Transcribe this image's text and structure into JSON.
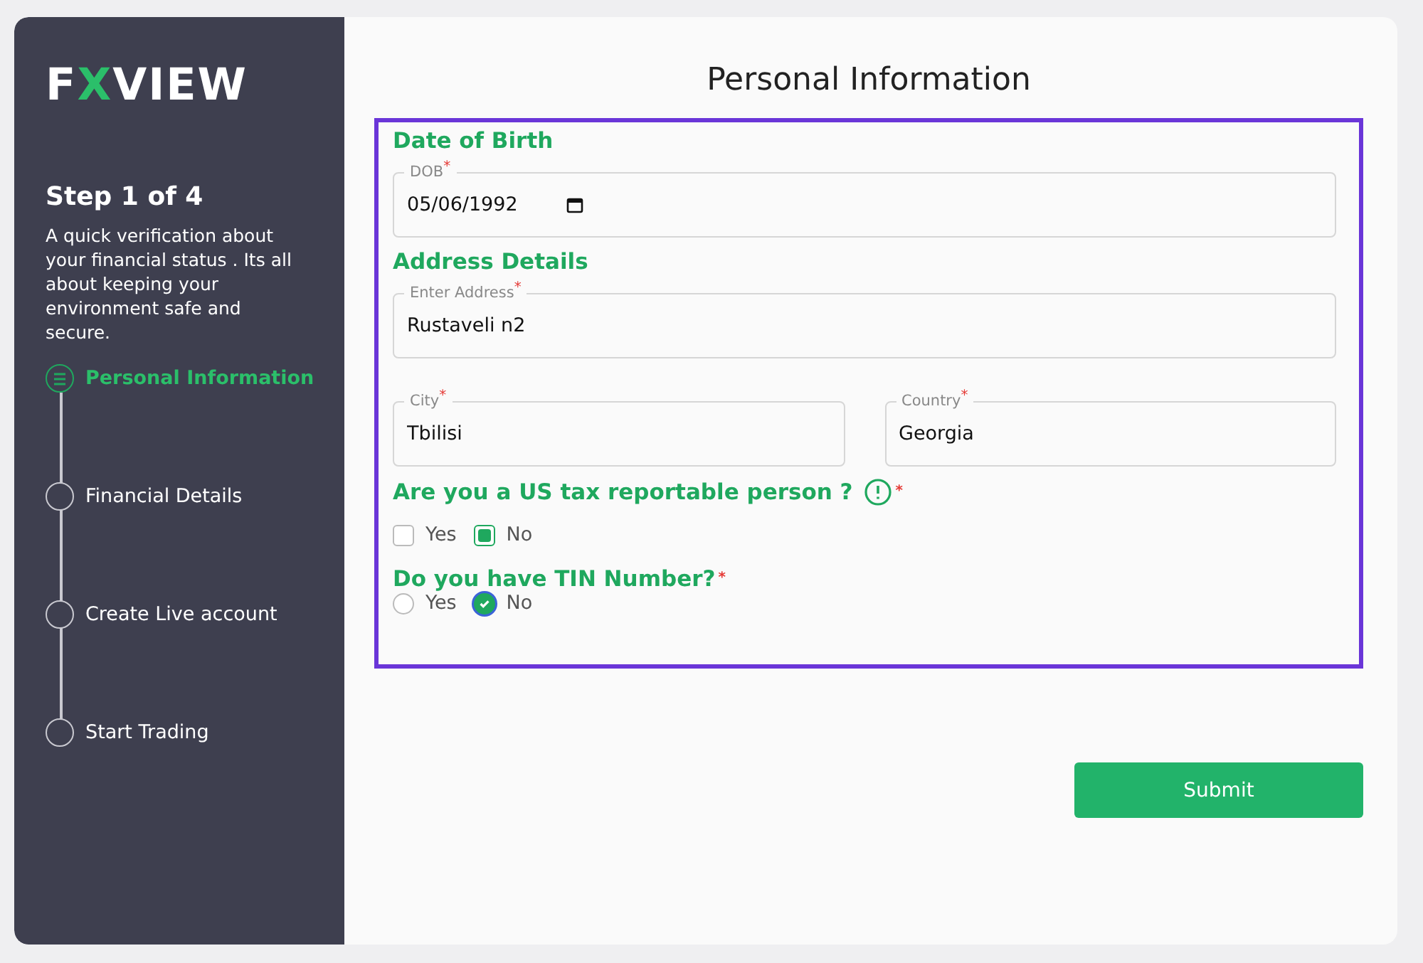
{
  "sidebar": {
    "logo": {
      "prefix": "F",
      "accent": "X",
      "suffix": "VIEW"
    },
    "step_title": "Step 1 of 4",
    "description": "A quick verification about your financial status . Its all about keeping your environment safe and secure.",
    "steps": [
      {
        "label": "Personal Information",
        "selected": true
      },
      {
        "label": "Financial Details",
        "selected": false
      },
      {
        "label": "Create Live account",
        "selected": false
      },
      {
        "label": "Start Trading",
        "selected": false
      }
    ]
  },
  "form": {
    "title": "Personal Information",
    "highlighted": true,
    "sections": [
      {
        "heading": "Date of Birth",
        "rows": [
          [
            {
              "label": "DOB",
              "required_mark": "*",
              "value": "05/06/1992",
              "kind": "date"
            }
          ]
        ]
      },
      {
        "heading": "Address Details",
        "rows": [
          [
            {
              "label": "Enter Address",
              "required_mark": "*",
              "value": "Rustaveli n2",
              "kind": "text"
            }
          ],
          [
            {
              "label": "City",
              "required_mark": "*",
              "value": "Tbilisi",
              "kind": "text"
            },
            {
              "label": "Country",
              "required_mark": "*",
              "value": "Georgia",
              "kind": "text"
            }
          ]
        ]
      }
    ],
    "questions": [
      {
        "text": "Are you a US tax reportable person ?",
        "info": true,
        "required_mark": "*",
        "kind": "checkbox",
        "options": [
          {
            "label": "Yes",
            "checked": false
          },
          {
            "label": "No",
            "checked": true
          }
        ]
      },
      {
        "text": "Do you have TIN Number?",
        "info": false,
        "required_mark": "*",
        "kind": "radio",
        "options": [
          {
            "label": "Yes",
            "checked": false
          },
          {
            "label": "No",
            "checked": true
          }
        ]
      }
    ],
    "submit": "Submit"
  }
}
